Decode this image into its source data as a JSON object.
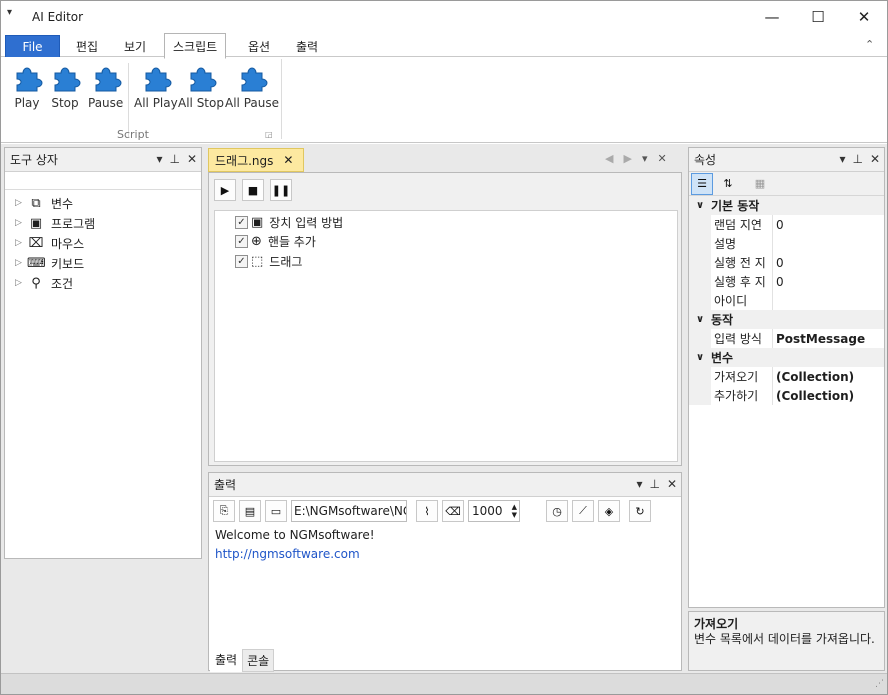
{
  "window": {
    "title": "AI Editor",
    "controls": [
      "—",
      "☐",
      "✕"
    ]
  },
  "menu": {
    "file": "File",
    "tabs": [
      "편집",
      "보기",
      "스크립트",
      "옵션",
      "출력"
    ],
    "collapse": "⌃"
  },
  "ribbon": {
    "buttons": [
      "Play",
      "Stop",
      "Pause",
      "All Play",
      "All Stop",
      "All Pause"
    ],
    "group_label": "Script"
  },
  "toolbox": {
    "title": "도구 상자",
    "items": [
      "변수",
      "프로그램",
      "마우스",
      "키보드",
      "조건"
    ]
  },
  "editor": {
    "tab_title": "드래그.ngs",
    "tab_close": "✕",
    "nodes": [
      "장치 입력 방법",
      "핸들 추가",
      "드래그"
    ]
  },
  "output": {
    "title": "출력",
    "path_value": "E:\\NGMsoftware\\NG",
    "number_value": "1000",
    "lines": [
      "Welcome to NGMsoftware!",
      "http://ngmsoftware.com"
    ],
    "tabs": [
      "출력",
      "콘솔"
    ]
  },
  "properties": {
    "title": "속성",
    "categories": [
      {
        "name": "기본 동작",
        "rows": [
          {
            "name": "랜덤 지연",
            "value": "0"
          },
          {
            "name": "설명",
            "value": ""
          },
          {
            "name": "실행 전 지",
            "value": "0"
          },
          {
            "name": "실행 후 지",
            "value": "0"
          },
          {
            "name": "아이디",
            "value": ""
          }
        ]
      },
      {
        "name": "동작",
        "rows": [
          {
            "name": "입력 방식",
            "value": "PostMessage"
          }
        ]
      },
      {
        "name": "변수",
        "rows": [
          {
            "name": "가져오기",
            "value": "(Collection)"
          },
          {
            "name": "추가하기",
            "value": "(Collection)"
          }
        ]
      }
    ],
    "desc_title": "가져오기",
    "desc_text": "변수 목록에서 데이터를 가져옵니다."
  },
  "colors": {
    "accent": "#2f6fd0",
    "tab_highlight": "#fde9a0"
  }
}
